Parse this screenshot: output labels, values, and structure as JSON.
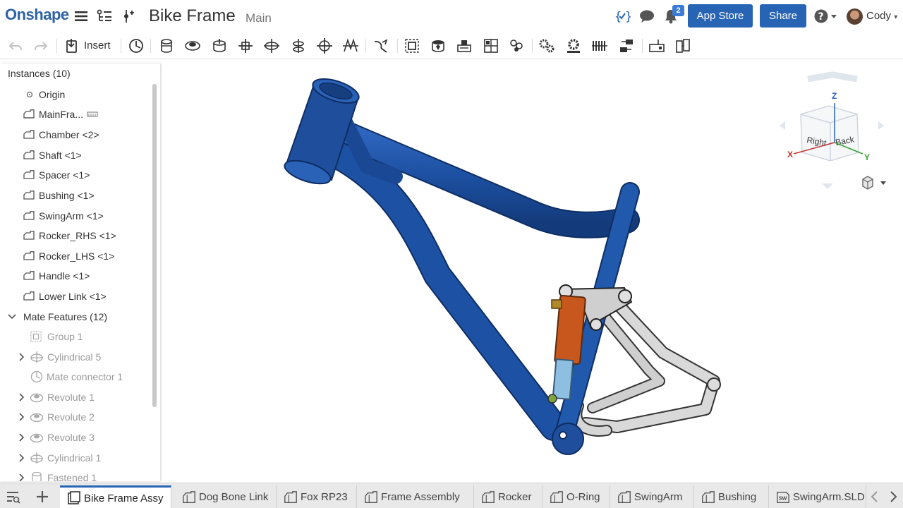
{
  "app": {
    "logo": "Onshape"
  },
  "document": {
    "title": "Bike Frame",
    "branch": "Main"
  },
  "header": {
    "notifications_count": "2",
    "app_store_label": "App Store",
    "share_label": "Share",
    "help_icon": "help-icon",
    "user_name": "Cody"
  },
  "toolbar": {
    "insert_label": "Insert",
    "tools": [
      "undo-icon",
      "redo-icon",
      "insert-icon",
      "mate-connector-icon",
      "fastened-mate-icon",
      "revolute-mate-icon",
      "slider-mate-icon",
      "planar-mate-icon",
      "cylindrical-mate-icon",
      "pin-slot-mate-icon",
      "ball-mate-icon",
      "parallel-mate-icon",
      "tangent-mate-icon",
      "group-icon",
      "replicate-icon",
      "pattern-icon",
      "explode-icon",
      "linear-pattern-icon",
      "gear-relation-icon",
      "rack-pinion-icon",
      "screw-relation-icon",
      "linear-relation-icon",
      "section-view-icon",
      "measure-icon"
    ]
  },
  "instances": {
    "header": "Instances (10)",
    "items": [
      {
        "label": "Origin",
        "kind": "origin"
      },
      {
        "label": "MainFra...",
        "kind": "part",
        "extra_icon": "sketch-icon"
      },
      {
        "label": "Chamber <2>",
        "kind": "part"
      },
      {
        "label": "Shaft <1>",
        "kind": "part"
      },
      {
        "label": "Spacer <1>",
        "kind": "part"
      },
      {
        "label": "Bushing <1>",
        "kind": "part"
      },
      {
        "label": "SwingArm <1>",
        "kind": "part"
      },
      {
        "label": "Rocker_RHS <1>",
        "kind": "part"
      },
      {
        "label": "Rocker_LHS <1>",
        "kind": "part"
      },
      {
        "label": "Handle <1>",
        "kind": "part"
      },
      {
        "label": "Lower Link <1>",
        "kind": "part"
      }
    ]
  },
  "mate_features": {
    "header": "Mate Features (12)",
    "items": [
      {
        "label": "Group 1",
        "icon": "group-icon",
        "expandable": false
      },
      {
        "label": "Cylindrical 5",
        "icon": "cylindrical-icon",
        "expandable": true
      },
      {
        "label": "Mate connector 1",
        "icon": "mate-connector-icon",
        "expandable": false
      },
      {
        "label": "Revolute 1",
        "icon": "revolute-icon",
        "expandable": true
      },
      {
        "label": "Revolute 2",
        "icon": "revolute-icon",
        "expandable": true
      },
      {
        "label": "Revolute 3",
        "icon": "revolute-icon",
        "expandable": true
      },
      {
        "label": "Cylindrical 1",
        "icon": "cylindrical-icon",
        "expandable": true
      },
      {
        "label": "Fastened 1",
        "icon": "fastened-icon",
        "expandable": true
      }
    ]
  },
  "view_cube": {
    "face_right": "Right",
    "face_back": "Back",
    "axis_x": "X",
    "axis_y": "Y",
    "axis_z": "Z"
  },
  "tabs": [
    {
      "label": "Bike Frame Assy",
      "active": true,
      "icon": "assembly-tab-icon"
    },
    {
      "label": "Dog Bone Link",
      "active": false,
      "icon": "part-studio-tab-icon"
    },
    {
      "label": "Fox RP23",
      "active": false,
      "icon": "part-studio-tab-icon"
    },
    {
      "label": "Frame Assembly",
      "active": false,
      "icon": "part-studio-tab-icon"
    },
    {
      "label": "Rocker",
      "active": false,
      "icon": "part-studio-tab-icon"
    },
    {
      "label": "O-Ring",
      "active": false,
      "icon": "part-studio-tab-icon"
    },
    {
      "label": "SwingArm",
      "active": false,
      "icon": "part-studio-tab-icon"
    },
    {
      "label": "Bushing",
      "active": false,
      "icon": "part-studio-tab-icon"
    },
    {
      "label": "SwingArm.SLD",
      "active": false,
      "icon": "solidworks-file-icon"
    }
  ],
  "colors": {
    "brand": "#2d62a6",
    "button": "#2864b4",
    "frame": "#1f4f9c",
    "shock": "#c8571d"
  }
}
